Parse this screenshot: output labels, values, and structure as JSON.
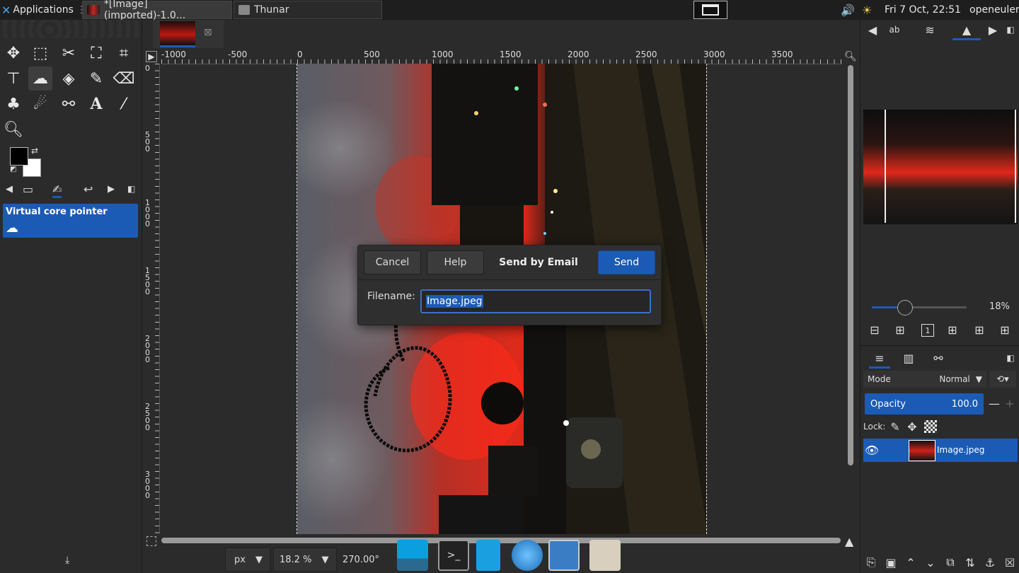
{
  "topbar": {
    "applications_label": "Applications",
    "tasks": [
      {
        "label": "*[Image] (imported)-1.0..."
      },
      {
        "label": "Thunar"
      }
    ],
    "datetime": "Fri  7 Oct, 22:51",
    "user": "openeuler"
  },
  "toolbox": {
    "tab_labels": [],
    "device_status": {
      "title": "Virtual core pointer"
    }
  },
  "canvas": {
    "hruler_labels": [
      "-1000",
      "-500",
      "0",
      "500",
      "1000",
      "1500",
      "2000",
      "2500",
      "3000",
      "3500"
    ],
    "vruler_labels": [
      "0",
      "500",
      "1000",
      "1500",
      "2000",
      "2500",
      "3000"
    ],
    "unit": "px",
    "zoom": "18.2 %",
    "rotation": "270.00°"
  },
  "dialog": {
    "cancel_label": "Cancel",
    "help_label": "Help",
    "title": "Send by Email",
    "send_label": "Send",
    "filename_label": "Filename:",
    "filename_value": "Image.jpeg"
  },
  "navigator": {
    "zoom_percent": "18%"
  },
  "layers": {
    "mode_label": "Mode",
    "mode_value": "Normal",
    "opacity_label": "Opacity",
    "opacity_value": "100.0",
    "lock_label": "Lock:",
    "layer_name": "Image.jpeg"
  },
  "colors": {
    "accent": "#1c5bb5",
    "panel": "#2b2b2b",
    "sky_red": "#e02a1a"
  }
}
